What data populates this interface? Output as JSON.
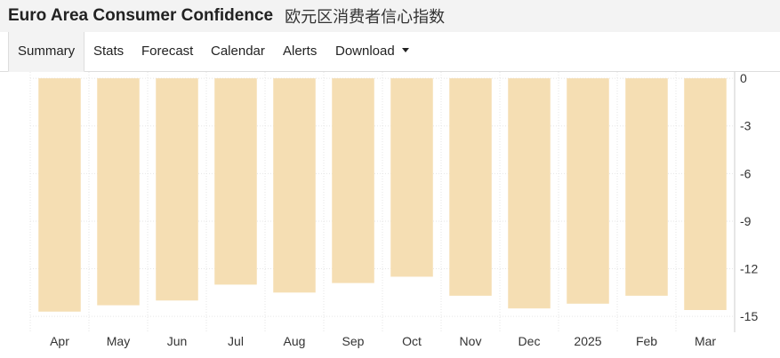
{
  "header": {
    "title_en": "Euro Area Consumer Confidence",
    "title_cn": "欧元区消费者信心指数"
  },
  "tabs": [
    {
      "label": "Summary",
      "active": true
    },
    {
      "label": "Stats"
    },
    {
      "label": "Forecast"
    },
    {
      "label": "Calendar"
    },
    {
      "label": "Alerts"
    },
    {
      "label": "Download",
      "dropdown": true
    }
  ],
  "colors": {
    "bar": "#f5deb3",
    "grid": "#e6e6e6",
    "axis_text": "#333333"
  },
  "chart_data": {
    "type": "bar",
    "categories": [
      "Apr",
      "May",
      "Jun",
      "Jul",
      "Aug",
      "Sep",
      "Oct",
      "Nov",
      "Dec",
      "2025",
      "Feb",
      "Mar"
    ],
    "values": [
      -14.7,
      -14.3,
      -14.0,
      -13.0,
      -13.5,
      -12.9,
      -12.5,
      -13.7,
      -14.5,
      -14.2,
      -13.7,
      -14.6
    ],
    "ylim": [
      -16,
      0.4
    ],
    "yticks": [
      "0",
      "-3",
      "-6",
      "-9",
      "-12",
      "-15"
    ],
    "ytick_values": [
      0,
      -3,
      -6,
      -9,
      -12,
      -15
    ],
    "y_axis_position": "right",
    "grid": true
  }
}
